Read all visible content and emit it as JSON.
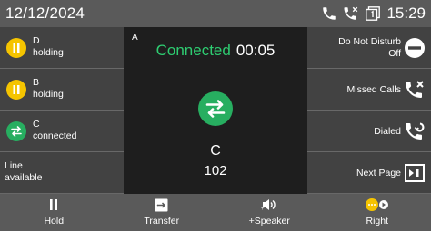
{
  "topbar": {
    "date": "12/12/2024",
    "time": "15:29"
  },
  "line_keys": [
    {
      "label": "D",
      "status": "holding",
      "icon": "pause-icon"
    },
    {
      "label": "B",
      "status": "holding",
      "icon": "pause-icon"
    },
    {
      "label": "C",
      "status": "connected",
      "icon": "transfer-arrows-icon"
    },
    {
      "label": "Line",
      "status": "available",
      "icon": ""
    }
  ],
  "call": {
    "account": "A",
    "state": "Connected",
    "duration": "00:05",
    "name": "C",
    "number": "102"
  },
  "dss_keys": [
    {
      "label_line1": "Do Not Disturb",
      "label_line2": "Off",
      "icon": "dnd-icon"
    },
    {
      "label_line1": "Missed Calls",
      "label_line2": "",
      "icon": "missed-call-icon"
    },
    {
      "label_line1": "Dialed",
      "label_line2": "",
      "icon": "dialed-call-icon"
    },
    {
      "label_line1": "Next Page",
      "label_line2": "",
      "icon": "next-page-icon"
    }
  ],
  "softkeys": [
    {
      "label": "Hold",
      "icon": "hold-icon"
    },
    {
      "label": "Transfer",
      "icon": "transfer-icon"
    },
    {
      "label": "+Speaker",
      "icon": "speaker-icon"
    },
    {
      "label": "Right",
      "icon": "right-nav-icon"
    }
  ],
  "colors": {
    "connected_green": "#2ecc71",
    "holding_yellow": "#f5c400",
    "topbar_bg": "#5a5a5a",
    "panel_bg": "#424242",
    "center_bg": "#1e1e1e"
  }
}
